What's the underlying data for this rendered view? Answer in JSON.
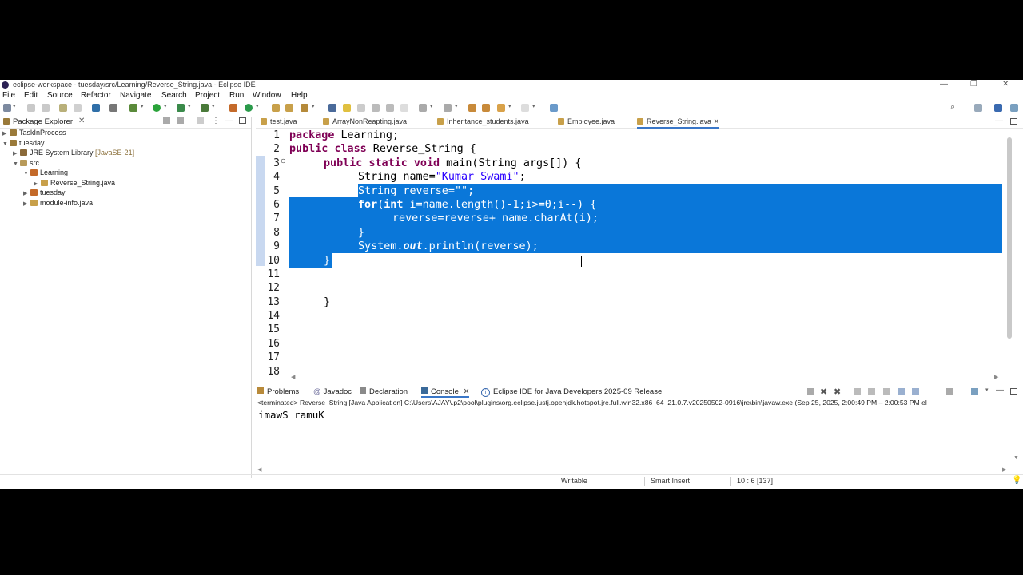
{
  "window": {
    "title": "eclipse-workspace - tuesday/src/Learning/Reverse_String.java - Eclipse IDE"
  },
  "menu": [
    "File",
    "Edit",
    "Source",
    "Refactor",
    "Navigate",
    "Search",
    "Project",
    "Run",
    "Window",
    "Help"
  ],
  "package_explorer": {
    "tab_label": "Package Explorer",
    "tree": [
      {
        "label": "TaskInProcess",
        "extra": ""
      },
      {
        "label": "tuesday",
        "extra": ""
      },
      {
        "label": "JRE System Library",
        "extra": "[JavaSE-21]"
      },
      {
        "label": "src",
        "extra": ""
      },
      {
        "label": "Learning",
        "extra": ""
      },
      {
        "label": "Reverse_String.java",
        "extra": ""
      },
      {
        "label": "tuesday",
        "extra": ""
      },
      {
        "label": "module-info.java",
        "extra": ""
      }
    ]
  },
  "editor_tabs": [
    "test.java",
    "ArrayNonReapting.java",
    "Inheritance_students.java",
    "Employee.java",
    "Reverse_String.java"
  ],
  "code": {
    "line_numbers": [
      "1",
      "2",
      "3",
      "4",
      "5",
      "6",
      "7",
      "8",
      "9",
      "10",
      "11",
      "12",
      "13",
      "14",
      "15",
      "16",
      "17",
      "18"
    ],
    "l1": {
      "kw": "package",
      "rest": " Learning;"
    },
    "l2": {
      "kw1": "public",
      "kw2": "class",
      "rest": " Reverse_String {"
    },
    "l3": {
      "kw1": "public",
      "kw2": "static",
      "kw3": "void",
      "rest": " main(String args[]) {"
    },
    "l4": {
      "pre": "String name=",
      "str": "\"Kumar Swami\"",
      "post": ";"
    },
    "l5": {
      "pre": "String reverse=",
      "str": "\"\"",
      "post": ";"
    },
    "l6": {
      "kw1": "for",
      "pre": "(",
      "kw2": "int",
      "rest": " i=name.length()-1;i>=0;i--) {"
    },
    "l7": {
      "text": "reverse=reverse+ name.charAt(i);"
    },
    "l8": {
      "text": "}"
    },
    "l9": {
      "pre": "System.",
      "fld": "out",
      "post": ".println(reverse);"
    },
    "l10": {
      "text": "}"
    },
    "l13": {
      "text": "}"
    }
  },
  "console": {
    "tabs": [
      "Problems",
      "Javadoc",
      "Declaration",
      "Console",
      "Eclipse IDE for Java Developers 2025-09 Release"
    ],
    "terminated": "<terminated> Reverse_String [Java Application] C:\\Users\\AJAY\\.p2\\pool\\plugins\\org.eclipse.justj.openjdk.hotspot.jre.full.win32.x86_64_21.0.7.v20250502-0916\\jre\\bin\\javaw.exe (Sep 25, 2025, 2:00:49 PM – 2:00:53 PM el",
    "output": "imawS ramuK"
  },
  "status": {
    "writable": "Writable",
    "insert_mode": "Smart Insert",
    "position": "10 : 6 [137]"
  },
  "colors": {
    "selection": "#0a77d9",
    "keyword": "#7f0055",
    "string": "#2a00ff"
  }
}
